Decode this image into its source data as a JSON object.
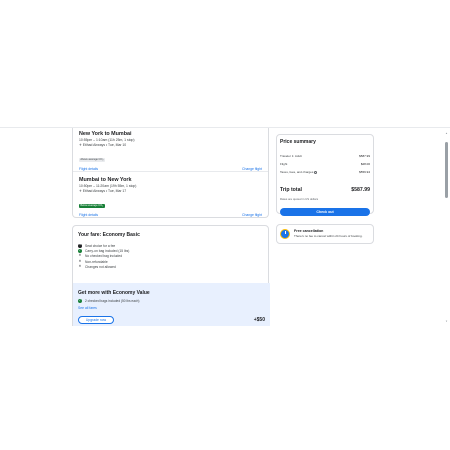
{
  "flights": [
    {
      "title": "New York to Mumbai",
      "times": "10:55pm – 1:10am (11h 25m, 1 stop)",
      "airline": "Etihad Airways • Tue, Mar 10",
      "badge": "Above average CO₂",
      "details_link": "Flight details",
      "change_link": "Change flight"
    },
    {
      "title": "Mumbai to New York",
      "times": "10:50pm – 11:20am (19h 55m, 1 stop)",
      "airline": "Etihad Airways • Tue, Mar 17",
      "badge": "Below average CO₂",
      "details_link": "Flight details",
      "change_link": "Change flight"
    }
  ],
  "fare": {
    "title": "Your fare: Economy Basic",
    "items": [
      {
        "icon": "dollar-icon",
        "text": "Seat choice for a fee"
      },
      {
        "icon": "check-icon",
        "text": "Carry-on bag included (15 lbs)"
      },
      {
        "icon": "x-icon",
        "text": "No checked bag included"
      },
      {
        "icon": "x-icon",
        "text": "Non-refundable"
      },
      {
        "icon": "x-icon",
        "text": "Changes not allowed"
      }
    ]
  },
  "upsell": {
    "title": "Get more with Economy Value",
    "item": "2 checked bags included (50 lbs each)",
    "link": "See all fares",
    "button": "Upgrade now",
    "price": "+$50"
  },
  "summary": {
    "title": "Price summary",
    "rows": [
      {
        "label": "Traveler 1: Adult",
        "amount": "$587.99"
      },
      {
        "label": "Flight",
        "amount": "$28.00"
      },
      {
        "label": "Taxes, fees, and charges",
        "amount": "$559.94"
      }
    ],
    "total_label": "Trip total",
    "total_amount": "$587.99",
    "note": "Rates are quoted in US dollars",
    "checkout": "Check out"
  },
  "cancellation": {
    "title": "Free cancellation",
    "text": "There's no fee to cancel within 24 hours of booking."
  },
  "colors": {
    "accent": "#1a73e8",
    "green": "#188038",
    "upsell_bg": "#e8f0fe"
  }
}
